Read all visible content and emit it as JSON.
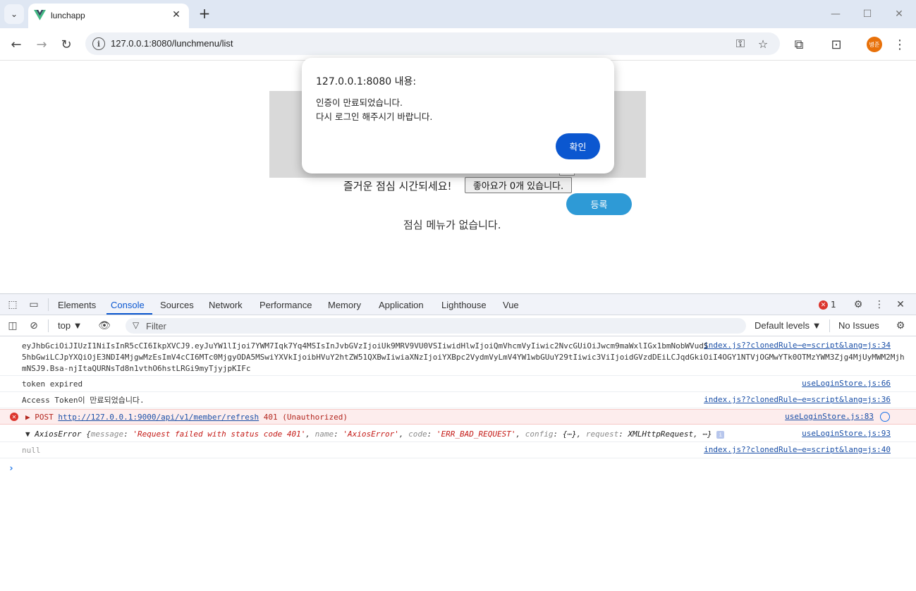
{
  "browser": {
    "tab_title": "lunchapp",
    "url": "127.0.0.1:8080/lunchmenu/list",
    "profile_initials": "병준",
    "tab_close": "✕",
    "new_tab": "+"
  },
  "app": {
    "greeting": "즐거운 점심 시간되세요!",
    "like_button": "좋아요가 0개 있습니다.",
    "register_button": "등록",
    "empty_message": "점심 메뉴가 없습니다."
  },
  "alert": {
    "title": "127.0.0.1:8080 내용:",
    "line1": "인증이 만료되었습니다.",
    "line2": "다시 로그인 해주시기 바랍니다.",
    "ok_button": "확인"
  },
  "devtools": {
    "tabs": [
      "Elements",
      "Console",
      "Sources",
      "Network",
      "Performance",
      "Memory",
      "Application",
      "Lighthouse",
      "Vue"
    ],
    "active_tab": "Console",
    "error_count": "1",
    "context": "top ▼",
    "filter_placeholder": "Filter",
    "levels": "Default levels ▼",
    "issues": "No Issues"
  },
  "console": {
    "jwt_line1": "eyJhbGciOiJIUzI1NiIsInR5cCI6IkpXVCJ9.eyJuYW1lIjoi7YWM7Iqk7Yq4MSIsInJvbGVzIjoiUk9MRV9VU0VSIiwidHlwIjoiQmVhcmVyIiwic2NvcGUiOiJwcm9maWxlIGx1bmNobWVudS",
    "jwt_line2": "5hbGwiLCJpYXQiOjE3NDI4MjgwMzEsImV4cCI6MTc0MjgyODA5MSwiYXVkIjoibHVuY2htZW51QXBwIiwiaXNzIjoiYXBpc2VydmVyLmV4YW1wbGUuY29tIiwic3ViIjoidGVzdDEiLCJqdGkiOiI4OGY1NTVjOGMwYTk0OTMzYWM3Zjg4MjUyMWM2Mjh",
    "jwt_line3": "mNSJ9.Bsa-njItaQURNsTd8n1vthO6hstLRGi9myTjyjpKIFc",
    "jwt_source": "index.js??clonedRule⋯e=script&lang=js:34",
    "token_expired": "token expired",
    "token_expired_source": "useLoginStore.js:66",
    "access_token": "Access Token이 만료되었습니다.",
    "access_token_source": "index.js??clonedRule⋯e=script&lang=js:36",
    "post_method": "POST",
    "post_url": "http://127.0.0.1:9000/api/v1/member/refresh",
    "post_status": "401 (Unauthorized)",
    "post_source": "useLoginStore.js:83",
    "axios_class": "AxiosError",
    "axios_message_key": "message",
    "axios_message": "'Request failed with status code 401'",
    "axios_name_key": "name",
    "axios_name": "'AxiosError'",
    "axios_code_key": "code",
    "axios_code": "'ERR_BAD_REQUEST'",
    "axios_config_key": "config",
    "axios_config": "{⋯}",
    "axios_request_key": "request",
    "axios_request": "XMLHttpRequest",
    "axios_rest": "⋯}",
    "axios_source": "useLoginStore.js:93",
    "null_value": "null",
    "null_source": "index.js??clonedRule⋯e=script&lang=js:40",
    "prompt": "›"
  },
  "colors": {
    "accent": "#0b57d0",
    "register": "#2e9ad6",
    "error": "#dc362e"
  }
}
